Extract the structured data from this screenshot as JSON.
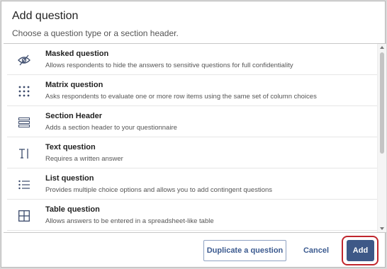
{
  "dialog": {
    "title": "Add question",
    "subtitle": "Choose a question type or a section header."
  },
  "items": [
    {
      "icon": "masked-icon",
      "name": "Masked question",
      "desc": "Allows respondents to hide the answers to sensitive questions for full confidentiality"
    },
    {
      "icon": "matrix-icon",
      "name": "Matrix question",
      "desc": "Asks respondents to evaluate one or more row items using the same set of column choices"
    },
    {
      "icon": "section-header-icon",
      "name": "Section Header",
      "desc": "Adds a section header to your questionnaire"
    },
    {
      "icon": "text-icon",
      "name": "Text question",
      "desc": "Requires a written answer"
    },
    {
      "icon": "list-icon",
      "name": "List question",
      "desc": "Provides multiple choice options and allows you to add contingent questions"
    },
    {
      "icon": "table-icon",
      "name": "Table question",
      "desc": "Allows answers to be entered in a spreadsheet-like table"
    }
  ],
  "footer": {
    "duplicate_label": "Duplicate a question",
    "cancel_label": "Cancel",
    "add_label": "Add"
  },
  "colors": {
    "accent": "#3e5887",
    "highlight_ring": "#c0262d"
  }
}
